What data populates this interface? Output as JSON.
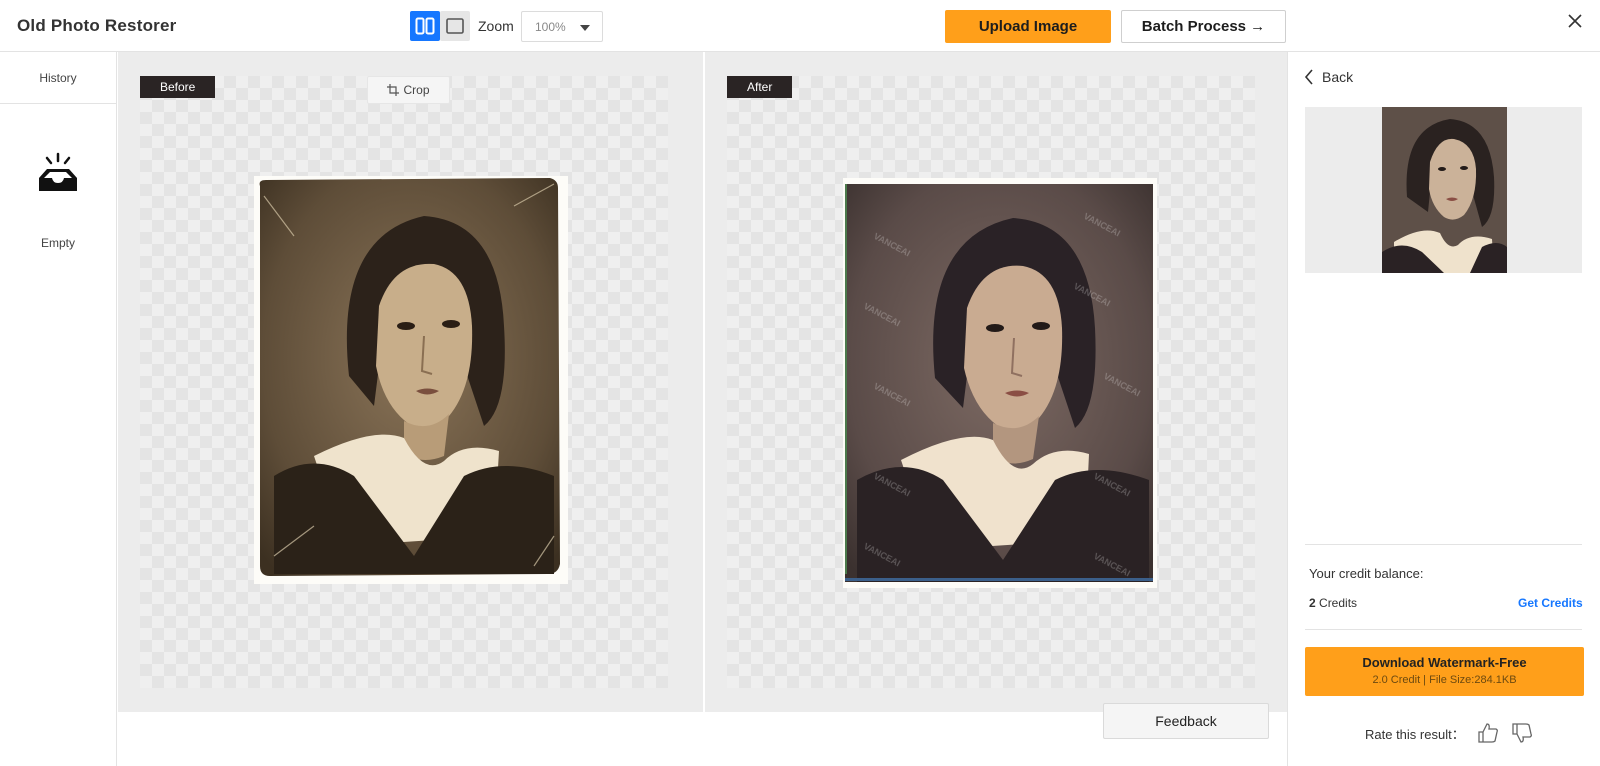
{
  "header": {
    "app_title": "Old Photo Restorer",
    "zoom_label": "Zoom",
    "zoom_value": "100%",
    "upload_label": "Upload Image",
    "batch_label": "Batch Process →"
  },
  "sidebar": {
    "history_label": "History",
    "empty_label": "Empty"
  },
  "workspace": {
    "before_tag": "Before",
    "after_tag": "After",
    "crop_label": "Crop",
    "watermark_text": "VANCEAI"
  },
  "feedback": {
    "label": "Feedback"
  },
  "right_panel": {
    "back_label": "Back",
    "credit_balance_label": "Your credit balance:",
    "credit_amount": "2",
    "credit_unit": " Credits",
    "get_credits_label": "Get Credits",
    "download_title": "Download Watermark-Free",
    "download_subtitle": "2.0 Credit | File Size:284.1KB",
    "rate_label": "Rate this result："
  },
  "colors": {
    "accent_orange": "#ff9f1a",
    "accent_blue": "#1677ff",
    "tag_dark": "#2a2424"
  }
}
